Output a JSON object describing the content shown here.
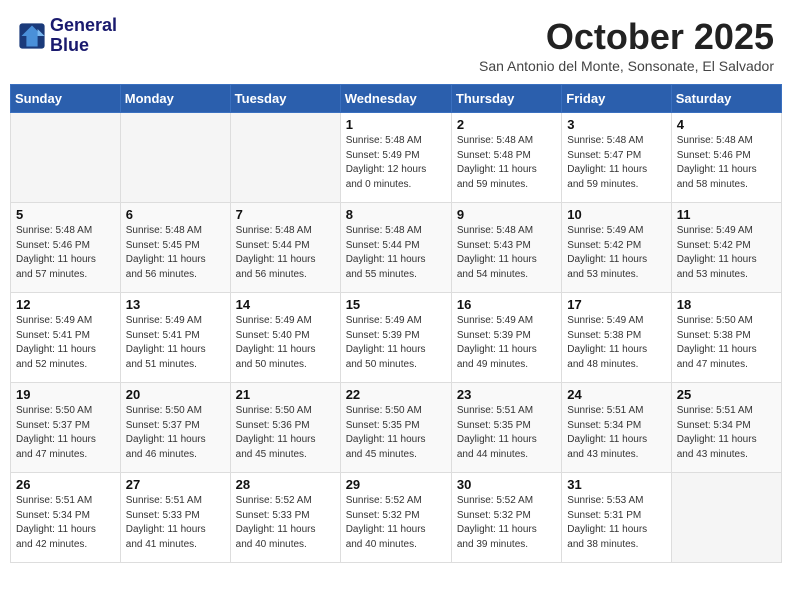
{
  "header": {
    "logo_line1": "General",
    "logo_line2": "Blue",
    "month": "October 2025",
    "location": "San Antonio del Monte, Sonsonate, El Salvador"
  },
  "weekdays": [
    "Sunday",
    "Monday",
    "Tuesday",
    "Wednesday",
    "Thursday",
    "Friday",
    "Saturday"
  ],
  "weeks": [
    [
      {
        "day": "",
        "info": ""
      },
      {
        "day": "",
        "info": ""
      },
      {
        "day": "",
        "info": ""
      },
      {
        "day": "1",
        "info": "Sunrise: 5:48 AM\nSunset: 5:49 PM\nDaylight: 12 hours\nand 0 minutes."
      },
      {
        "day": "2",
        "info": "Sunrise: 5:48 AM\nSunset: 5:48 PM\nDaylight: 11 hours\nand 59 minutes."
      },
      {
        "day": "3",
        "info": "Sunrise: 5:48 AM\nSunset: 5:47 PM\nDaylight: 11 hours\nand 59 minutes."
      },
      {
        "day": "4",
        "info": "Sunrise: 5:48 AM\nSunset: 5:46 PM\nDaylight: 11 hours\nand 58 minutes."
      }
    ],
    [
      {
        "day": "5",
        "info": "Sunrise: 5:48 AM\nSunset: 5:46 PM\nDaylight: 11 hours\nand 57 minutes."
      },
      {
        "day": "6",
        "info": "Sunrise: 5:48 AM\nSunset: 5:45 PM\nDaylight: 11 hours\nand 56 minutes."
      },
      {
        "day": "7",
        "info": "Sunrise: 5:48 AM\nSunset: 5:44 PM\nDaylight: 11 hours\nand 56 minutes."
      },
      {
        "day": "8",
        "info": "Sunrise: 5:48 AM\nSunset: 5:44 PM\nDaylight: 11 hours\nand 55 minutes."
      },
      {
        "day": "9",
        "info": "Sunrise: 5:48 AM\nSunset: 5:43 PM\nDaylight: 11 hours\nand 54 minutes."
      },
      {
        "day": "10",
        "info": "Sunrise: 5:49 AM\nSunset: 5:42 PM\nDaylight: 11 hours\nand 53 minutes."
      },
      {
        "day": "11",
        "info": "Sunrise: 5:49 AM\nSunset: 5:42 PM\nDaylight: 11 hours\nand 53 minutes."
      }
    ],
    [
      {
        "day": "12",
        "info": "Sunrise: 5:49 AM\nSunset: 5:41 PM\nDaylight: 11 hours\nand 52 minutes."
      },
      {
        "day": "13",
        "info": "Sunrise: 5:49 AM\nSunset: 5:41 PM\nDaylight: 11 hours\nand 51 minutes."
      },
      {
        "day": "14",
        "info": "Sunrise: 5:49 AM\nSunset: 5:40 PM\nDaylight: 11 hours\nand 50 minutes."
      },
      {
        "day": "15",
        "info": "Sunrise: 5:49 AM\nSunset: 5:39 PM\nDaylight: 11 hours\nand 50 minutes."
      },
      {
        "day": "16",
        "info": "Sunrise: 5:49 AM\nSunset: 5:39 PM\nDaylight: 11 hours\nand 49 minutes."
      },
      {
        "day": "17",
        "info": "Sunrise: 5:49 AM\nSunset: 5:38 PM\nDaylight: 11 hours\nand 48 minutes."
      },
      {
        "day": "18",
        "info": "Sunrise: 5:50 AM\nSunset: 5:38 PM\nDaylight: 11 hours\nand 47 minutes."
      }
    ],
    [
      {
        "day": "19",
        "info": "Sunrise: 5:50 AM\nSunset: 5:37 PM\nDaylight: 11 hours\nand 47 minutes."
      },
      {
        "day": "20",
        "info": "Sunrise: 5:50 AM\nSunset: 5:37 PM\nDaylight: 11 hours\nand 46 minutes."
      },
      {
        "day": "21",
        "info": "Sunrise: 5:50 AM\nSunset: 5:36 PM\nDaylight: 11 hours\nand 45 minutes."
      },
      {
        "day": "22",
        "info": "Sunrise: 5:50 AM\nSunset: 5:35 PM\nDaylight: 11 hours\nand 45 minutes."
      },
      {
        "day": "23",
        "info": "Sunrise: 5:51 AM\nSunset: 5:35 PM\nDaylight: 11 hours\nand 44 minutes."
      },
      {
        "day": "24",
        "info": "Sunrise: 5:51 AM\nSunset: 5:34 PM\nDaylight: 11 hours\nand 43 minutes."
      },
      {
        "day": "25",
        "info": "Sunrise: 5:51 AM\nSunset: 5:34 PM\nDaylight: 11 hours\nand 43 minutes."
      }
    ],
    [
      {
        "day": "26",
        "info": "Sunrise: 5:51 AM\nSunset: 5:34 PM\nDaylight: 11 hours\nand 42 minutes."
      },
      {
        "day": "27",
        "info": "Sunrise: 5:51 AM\nSunset: 5:33 PM\nDaylight: 11 hours\nand 41 minutes."
      },
      {
        "day": "28",
        "info": "Sunrise: 5:52 AM\nSunset: 5:33 PM\nDaylight: 11 hours\nand 40 minutes."
      },
      {
        "day": "29",
        "info": "Sunrise: 5:52 AM\nSunset: 5:32 PM\nDaylight: 11 hours\nand 40 minutes."
      },
      {
        "day": "30",
        "info": "Sunrise: 5:52 AM\nSunset: 5:32 PM\nDaylight: 11 hours\nand 39 minutes."
      },
      {
        "day": "31",
        "info": "Sunrise: 5:53 AM\nSunset: 5:31 PM\nDaylight: 11 hours\nand 38 minutes."
      },
      {
        "day": "",
        "info": ""
      }
    ]
  ]
}
